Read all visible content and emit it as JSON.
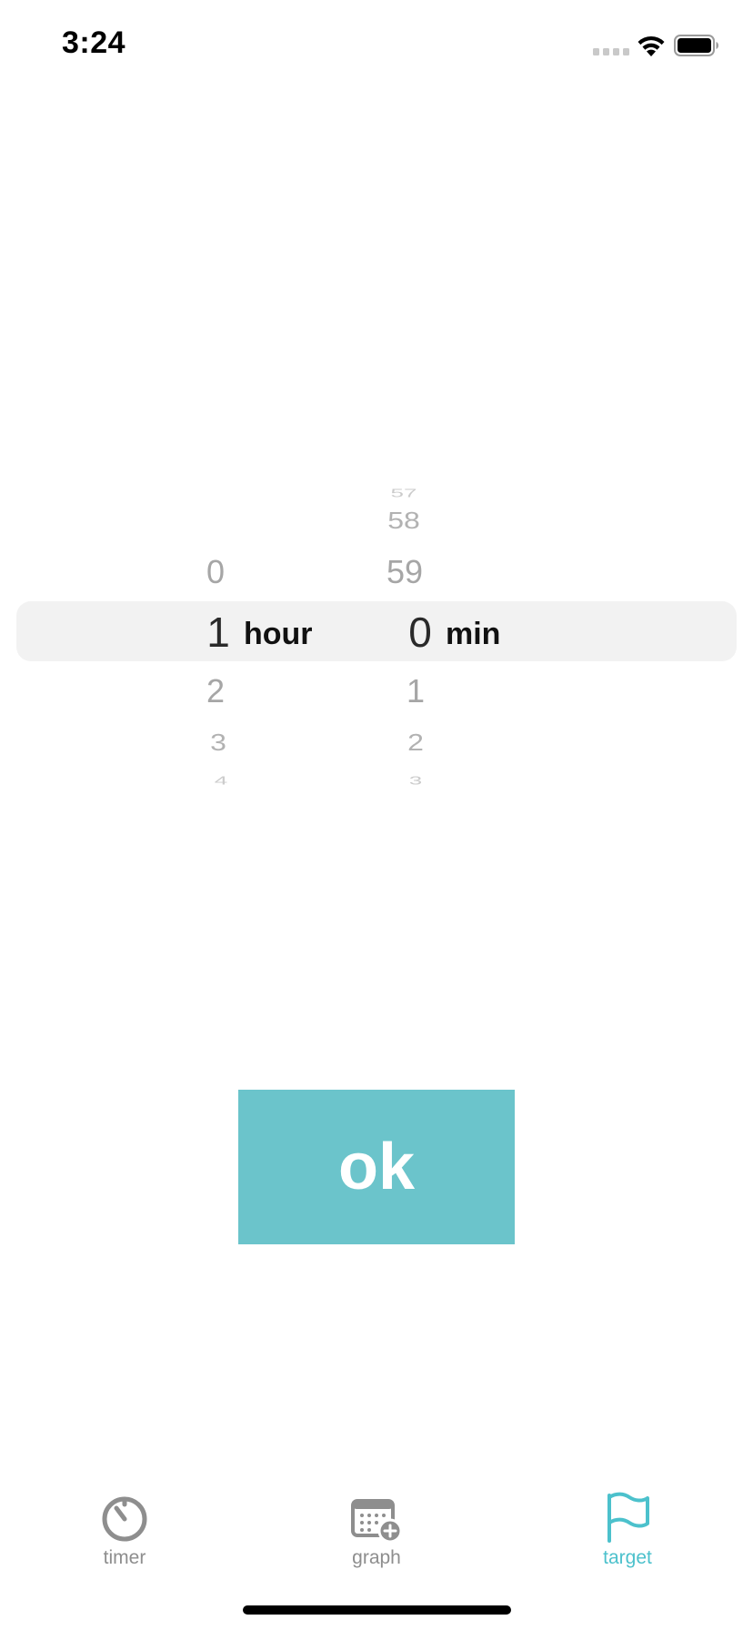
{
  "status_bar": {
    "time": "3:24"
  },
  "picker": {
    "hours": {
      "above": [
        "0"
      ],
      "selected": "1",
      "below": [
        "2",
        "3",
        "4"
      ],
      "unit": "hour"
    },
    "minutes": {
      "above": [
        "57",
        "58",
        "59"
      ],
      "selected": "0",
      "below": [
        "1",
        "2",
        "3"
      ],
      "unit": "min"
    }
  },
  "ok_button": {
    "label": "ok"
  },
  "tabs": [
    {
      "label": "timer",
      "icon": "timer-icon",
      "active": false
    },
    {
      "label": "graph",
      "icon": "calendar-add-icon",
      "active": false
    },
    {
      "label": "target",
      "icon": "flag-icon",
      "active": true
    }
  ],
  "colors": {
    "accent": "#4cc1cc",
    "button": "#6bc4cb",
    "inactive_tab": "#8e8e8e",
    "picker_highlight": "#f2f2f2"
  }
}
